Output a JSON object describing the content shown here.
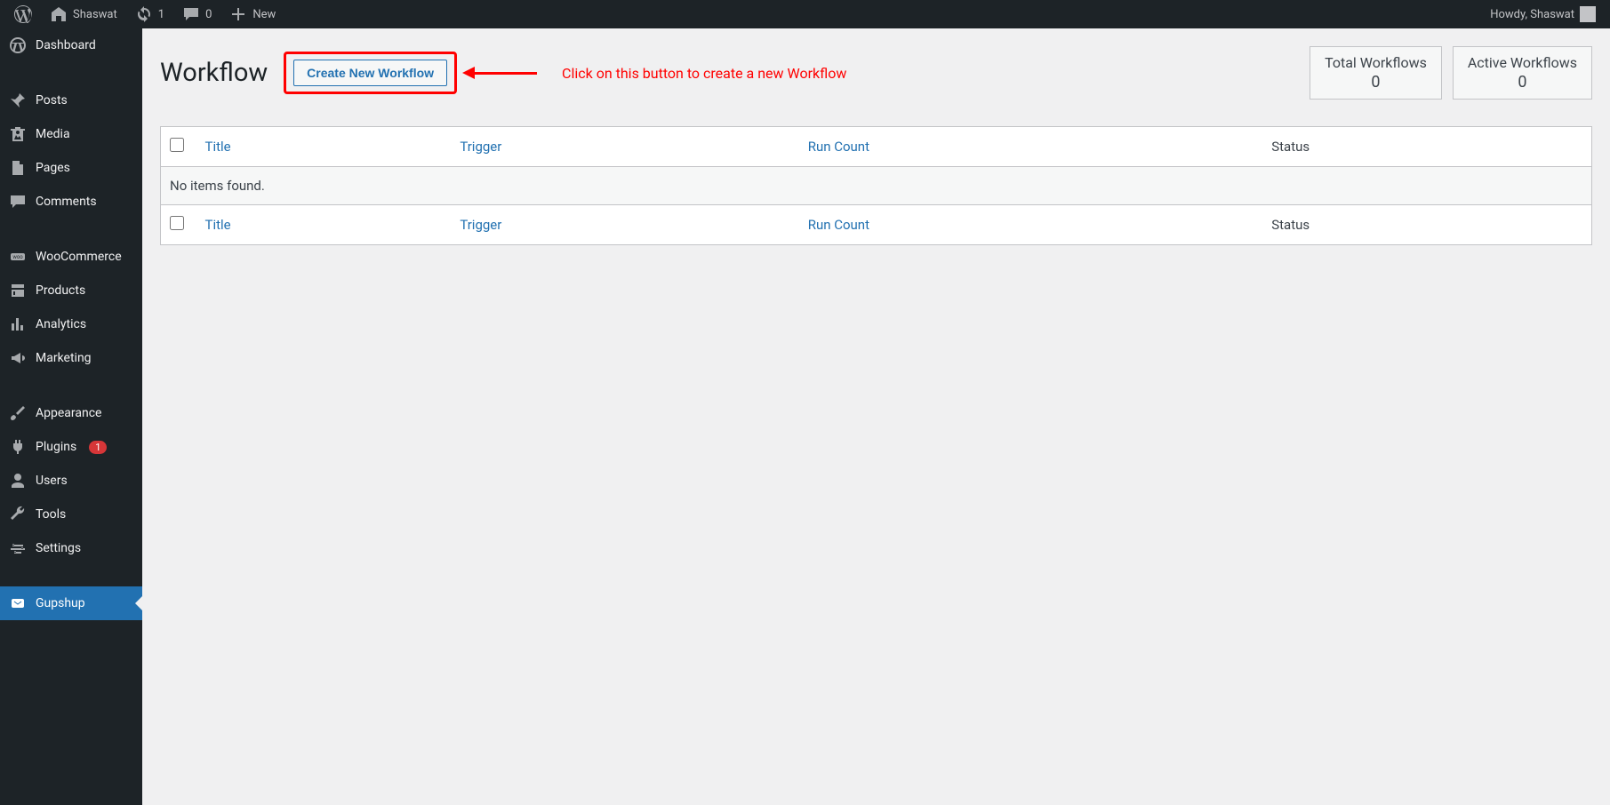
{
  "topbar": {
    "site_name": "Shaswat",
    "updates_count": "1",
    "comments_count": "0",
    "new_label": "New",
    "howdy": "Howdy, Shaswat"
  },
  "sidebar": {
    "items": [
      {
        "label": "Dashboard",
        "icon": "dashboard"
      },
      {
        "label": "Posts",
        "icon": "pin"
      },
      {
        "label": "Media",
        "icon": "media"
      },
      {
        "label": "Pages",
        "icon": "page"
      },
      {
        "label": "Comments",
        "icon": "comment"
      },
      {
        "label": "WooCommerce",
        "icon": "woo"
      },
      {
        "label": "Products",
        "icon": "products"
      },
      {
        "label": "Analytics",
        "icon": "analytics"
      },
      {
        "label": "Marketing",
        "icon": "marketing"
      },
      {
        "label": "Appearance",
        "icon": "appearance"
      },
      {
        "label": "Plugins",
        "icon": "plugins",
        "badge": "1"
      },
      {
        "label": "Users",
        "icon": "users"
      },
      {
        "label": "Tools",
        "icon": "tools"
      },
      {
        "label": "Settings",
        "icon": "settings"
      },
      {
        "label": "Gupshup",
        "icon": "gupshup",
        "active": true
      }
    ]
  },
  "page": {
    "title": "Workflow",
    "create_button": "Create New Workflow",
    "annotation": "Click on this button to create a new Workflow"
  },
  "stats": [
    {
      "label": "Total Workflows",
      "value": "0"
    },
    {
      "label": "Active Workflows",
      "value": "0"
    }
  ],
  "table": {
    "columns": {
      "title": "Title",
      "trigger": "Trigger",
      "run_count": "Run Count",
      "status": "Status"
    },
    "empty": "No items found."
  }
}
